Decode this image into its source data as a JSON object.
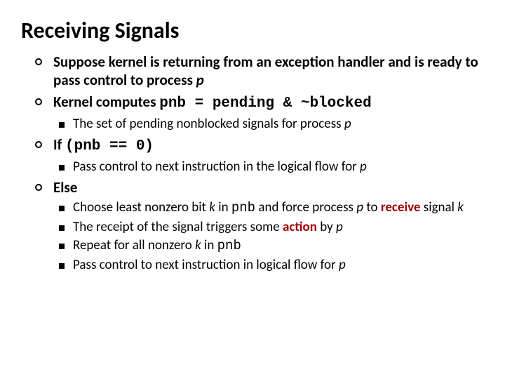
{
  "title": "Receiving Signals",
  "b1": {
    "a": "Suppose kernel is returning from an exception handler and is ready to pass control to process ",
    "p": "p"
  },
  "b2": {
    "a": "Kernel computes ",
    "code": "pnb = pending & ~blocked"
  },
  "b2s1": {
    "a": "The set of pending nonblocked signals for process ",
    "p": "p"
  },
  "b3": {
    "a": "If ",
    "code": "(pnb == 0)"
  },
  "b3s1": {
    "a": "Pass control to next instruction in the logical flow for ",
    "p": "p"
  },
  "b4": {
    "a": "Else"
  },
  "b4s1": {
    "a": "Choose least nonzero bit ",
    "k": "k",
    "b": " in ",
    "pnb": "pnb",
    "c": "  and force process ",
    "p": "p",
    "d": " to ",
    "recv": "receive",
    "e": " signal ",
    "k2": "k"
  },
  "b4s2": {
    "a": "The receipt of the signal triggers some ",
    "action": "action",
    "b": " by ",
    "p": "p"
  },
  "b4s3": {
    "a": "Repeat for all nonzero ",
    "k": "k",
    "b": " in ",
    "pnb": "pnb"
  },
  "b4s4": {
    "a": "Pass control to next instruction in logical flow for ",
    "p": "p"
  }
}
